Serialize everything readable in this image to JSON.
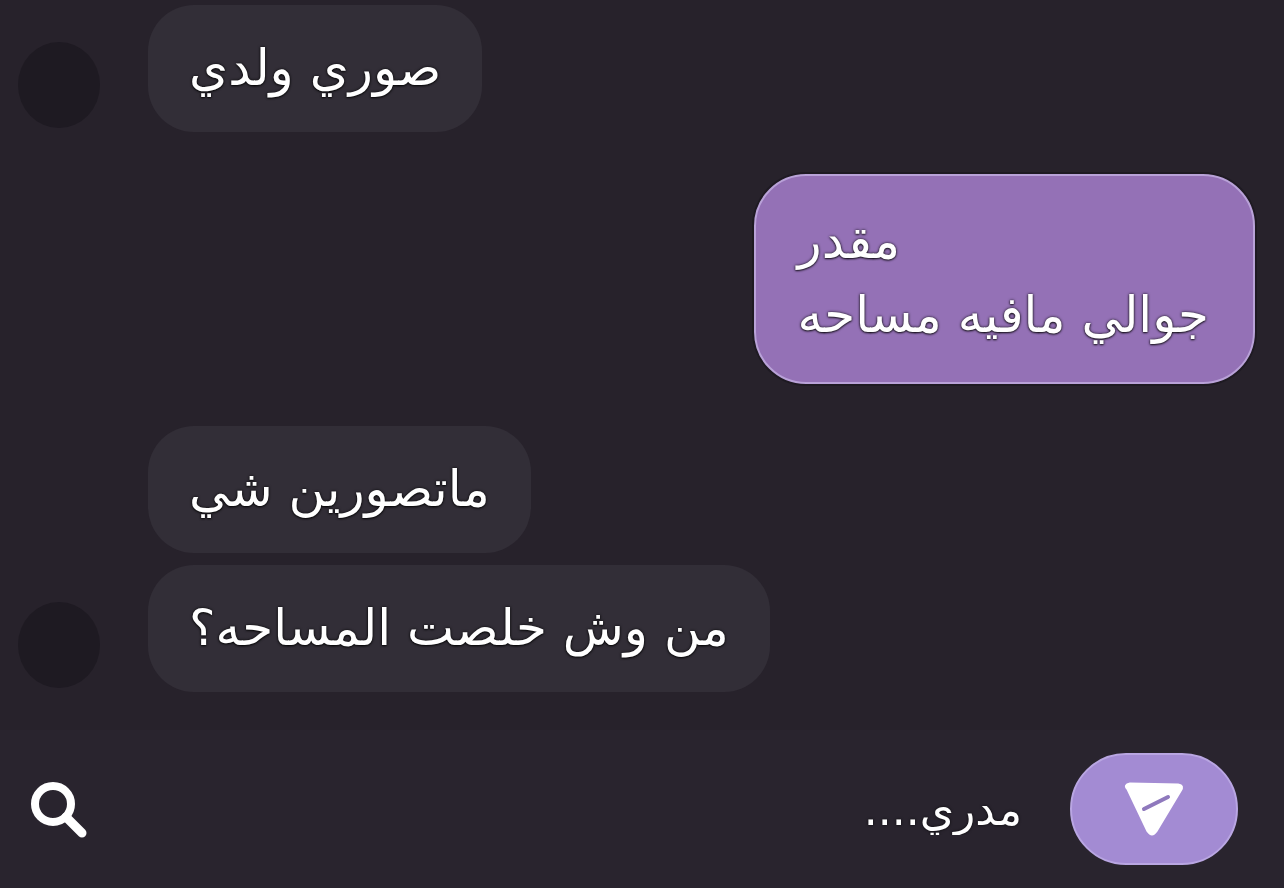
{
  "messages": [
    {
      "kind": "received",
      "show_avatar": true,
      "lines": [
        "صوري ولدي"
      ]
    },
    {
      "kind": "sent",
      "show_avatar": false,
      "lines": [
        "مقدر",
        "جوالي مافيه مساحه"
      ]
    },
    {
      "kind": "received",
      "show_avatar": false,
      "lines": [
        "ماتصورين شي"
      ]
    },
    {
      "kind": "received",
      "show_avatar": true,
      "lines": [
        "من وش خلصت المساحه؟"
      ]
    }
  ],
  "composer": {
    "value": "مدري...."
  }
}
